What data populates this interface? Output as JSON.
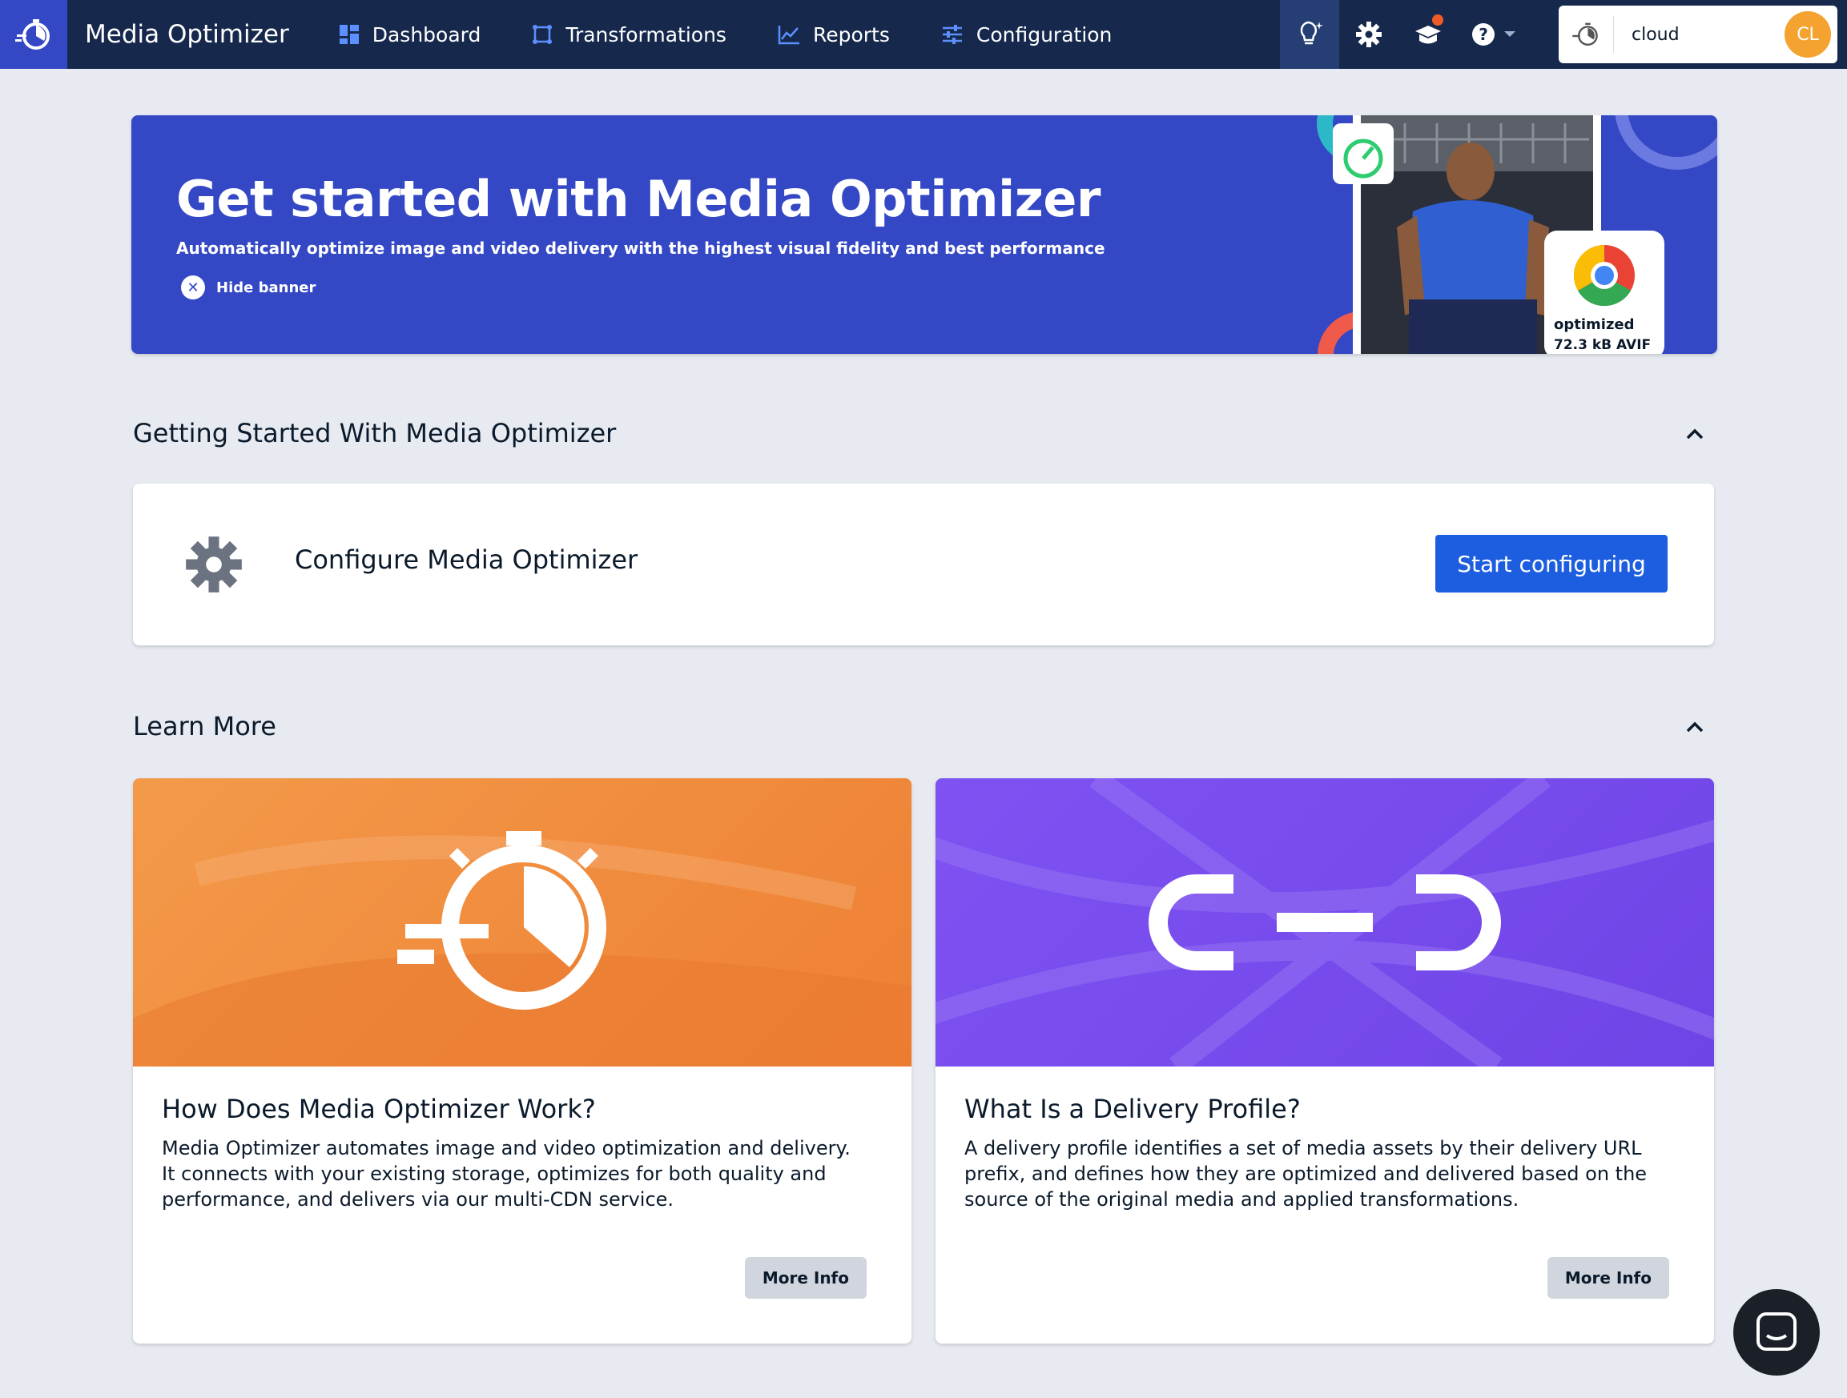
{
  "header": {
    "app_title": "Media Optimizer",
    "nav": [
      {
        "label": "Dashboard",
        "icon": "dashboard-icon"
      },
      {
        "label": "Transformations",
        "icon": "transformations-icon"
      },
      {
        "label": "Reports",
        "icon": "reports-icon"
      },
      {
        "label": "Configuration",
        "icon": "configuration-icon"
      }
    ],
    "account": {
      "name": "cloud",
      "initials": "CL"
    },
    "colors": {
      "bar": "#16294d",
      "logo_bg": "#3448c5",
      "accent_dot": "#f05a28",
      "avatar": "#f4a230"
    }
  },
  "banner": {
    "title": "Get started with Media Optimizer",
    "subtitle": "Automatically optimize image and video delivery with the highest visual fidelity and best performance",
    "hide_label": "Hide banner",
    "badge_line1": "optimized",
    "badge_line2": "72.3 kB AVIF",
    "color": "#3448c5"
  },
  "getting_started": {
    "title": "Getting Started With Media Optimizer",
    "item_label": "Configure Media Optimizer",
    "button": "Start configuring"
  },
  "learn_more": {
    "title": "Learn More",
    "cards": [
      {
        "title": "How Does Media Optimizer Work?",
        "text": "Media Optimizer automates image and video optimization and delivery. It connects with your existing storage, optimizes for both quality and performance, and delivers via our multi-CDN service.",
        "button": "More Info",
        "color": "#f08a3c"
      },
      {
        "title": "What Is a Delivery Profile?",
        "text": "A delivery profile identifies a set of media assets by their delivery URL prefix, and defines how they are optimized and delivered based on the source of the original media and applied transformations.",
        "button": "More Info",
        "color": "#7b4df0"
      }
    ]
  }
}
